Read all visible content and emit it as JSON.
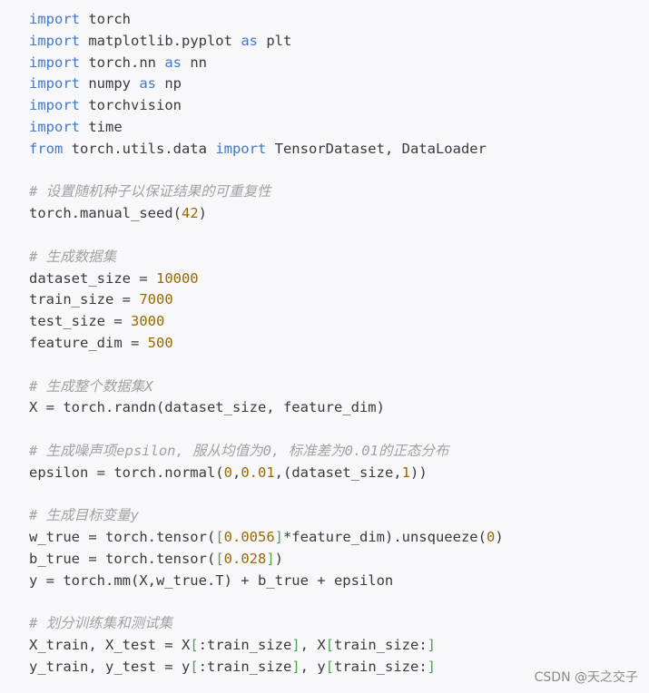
{
  "code": {
    "lines": [
      {
        "segments": [
          {
            "t": "import",
            "k": "kw"
          },
          {
            "t": " torch",
            "k": "plain"
          }
        ]
      },
      {
        "segments": [
          {
            "t": "import",
            "k": "kw"
          },
          {
            "t": " matplotlib.pyplot ",
            "k": "plain"
          },
          {
            "t": "as",
            "k": "kw"
          },
          {
            "t": " plt",
            "k": "plain"
          }
        ]
      },
      {
        "segments": [
          {
            "t": "import",
            "k": "kw"
          },
          {
            "t": " torch.nn ",
            "k": "plain"
          },
          {
            "t": "as",
            "k": "kw"
          },
          {
            "t": " nn",
            "k": "plain"
          }
        ]
      },
      {
        "segments": [
          {
            "t": "import",
            "k": "kw"
          },
          {
            "t": " numpy ",
            "k": "plain"
          },
          {
            "t": "as",
            "k": "kw"
          },
          {
            "t": " np",
            "k": "plain"
          }
        ]
      },
      {
        "segments": [
          {
            "t": "import",
            "k": "kw"
          },
          {
            "t": " torchvision",
            "k": "plain"
          }
        ]
      },
      {
        "segments": [
          {
            "t": "import",
            "k": "kw"
          },
          {
            "t": " time",
            "k": "plain"
          }
        ]
      },
      {
        "segments": [
          {
            "t": "from",
            "k": "kw"
          },
          {
            "t": " torch.utils.data ",
            "k": "plain"
          },
          {
            "t": "import",
            "k": "kw"
          },
          {
            "t": " TensorDataset, DataLoader",
            "k": "plain"
          }
        ]
      },
      {
        "segments": []
      },
      {
        "segments": [
          {
            "t": "# 设置随机种子以保证结果的可重复性",
            "k": "cm"
          }
        ]
      },
      {
        "segments": [
          {
            "t": "torch.manual_seed(",
            "k": "plain"
          },
          {
            "t": "42",
            "k": "num"
          },
          {
            "t": ")",
            "k": "plain"
          }
        ]
      },
      {
        "segments": []
      },
      {
        "segments": [
          {
            "t": "# 生成数据集",
            "k": "cm"
          }
        ]
      },
      {
        "segments": [
          {
            "t": "dataset_size = ",
            "k": "plain"
          },
          {
            "t": "10000",
            "k": "num"
          }
        ]
      },
      {
        "segments": [
          {
            "t": "train_size = ",
            "k": "plain"
          },
          {
            "t": "7000",
            "k": "num"
          }
        ]
      },
      {
        "segments": [
          {
            "t": "test_size = ",
            "k": "plain"
          },
          {
            "t": "3000",
            "k": "num"
          }
        ]
      },
      {
        "segments": [
          {
            "t": "feature_dim = ",
            "k": "plain"
          },
          {
            "t": "500",
            "k": "num"
          }
        ]
      },
      {
        "segments": []
      },
      {
        "segments": [
          {
            "t": "# 生成整个数据集X",
            "k": "cm"
          }
        ]
      },
      {
        "segments": [
          {
            "t": "X = torch.randn(dataset_size, feature_dim)",
            "k": "plain"
          }
        ]
      },
      {
        "segments": []
      },
      {
        "segments": [
          {
            "t": "# 生成噪声项epsilon, 服从均值为0, 标准差为0.01的正态分布",
            "k": "cm"
          }
        ]
      },
      {
        "segments": [
          {
            "t": "epsilon = torch.normal(",
            "k": "plain"
          },
          {
            "t": "0",
            "k": "num"
          },
          {
            "t": ",",
            "k": "plain"
          },
          {
            "t": "0.01",
            "k": "num"
          },
          {
            "t": ",(dataset_size,",
            "k": "plain"
          },
          {
            "t": "1",
            "k": "num"
          },
          {
            "t": "))",
            "k": "plain"
          }
        ]
      },
      {
        "segments": []
      },
      {
        "segments": [
          {
            "t": "# 生成目标变量y",
            "k": "cm"
          }
        ]
      },
      {
        "segments": [
          {
            "t": "w_true = torch.tensor(",
            "k": "plain"
          },
          {
            "t": "[",
            "k": "brk"
          },
          {
            "t": "0.0056",
            "k": "num"
          },
          {
            "t": "]",
            "k": "brk"
          },
          {
            "t": "*feature_dim).unsqueeze(",
            "k": "plain"
          },
          {
            "t": "0",
            "k": "num"
          },
          {
            "t": ")",
            "k": "plain"
          }
        ]
      },
      {
        "segments": [
          {
            "t": "b_true = torch.tensor(",
            "k": "plain"
          },
          {
            "t": "[",
            "k": "brk"
          },
          {
            "t": "0.028",
            "k": "num"
          },
          {
            "t": "]",
            "k": "brk"
          },
          {
            "t": ")",
            "k": "plain"
          }
        ]
      },
      {
        "segments": [
          {
            "t": "y = torch.mm(X,w_true.T) + b_true + epsilon",
            "k": "plain"
          }
        ]
      },
      {
        "segments": []
      },
      {
        "segments": [
          {
            "t": "# 划分训练集和测试集",
            "k": "cm"
          }
        ]
      },
      {
        "segments": [
          {
            "t": "X_train, X_test = X",
            "k": "plain"
          },
          {
            "t": "[",
            "k": "brk"
          },
          {
            "t": ":train_size",
            "k": "plain"
          },
          {
            "t": "]",
            "k": "brk"
          },
          {
            "t": ", X",
            "k": "plain"
          },
          {
            "t": "[",
            "k": "brk"
          },
          {
            "t": "train_size:",
            "k": "plain"
          },
          {
            "t": "]",
            "k": "brk"
          }
        ]
      },
      {
        "segments": [
          {
            "t": "y_train, y_test = y",
            "k": "plain"
          },
          {
            "t": "[",
            "k": "brk"
          },
          {
            "t": ":train_size",
            "k": "plain"
          },
          {
            "t": "]",
            "k": "brk"
          },
          {
            "t": ", y",
            "k": "plain"
          },
          {
            "t": "[",
            "k": "brk"
          },
          {
            "t": "train_size:",
            "k": "plain"
          },
          {
            "t": "]",
            "k": "brk"
          }
        ]
      }
    ]
  },
  "watermark": {
    "text": "CSDN @天之交子"
  },
  "colors": {
    "background": "#f8f8fa",
    "keyword": "#4078c8",
    "number": "#986801",
    "comment": "#a0a1a7",
    "text": "#383a42"
  }
}
